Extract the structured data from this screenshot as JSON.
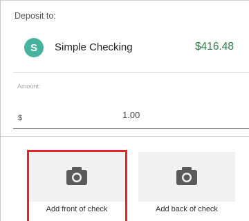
{
  "deposit": {
    "label": "Deposit to:",
    "account": {
      "icon_letter": "S",
      "icon_color": "#46b39e",
      "name": "Simple Checking",
      "balance": "$416.48",
      "balance_color": "#2f7a4a"
    }
  },
  "amount": {
    "label": "Amount:",
    "currency_symbol": "$",
    "value": "1.00"
  },
  "check_capture": {
    "front": {
      "label": "Add front of check",
      "icon": "camera-icon"
    },
    "back": {
      "label": "Add back of check",
      "icon": "camera-icon"
    },
    "highlight_color": "#e3222a"
  }
}
